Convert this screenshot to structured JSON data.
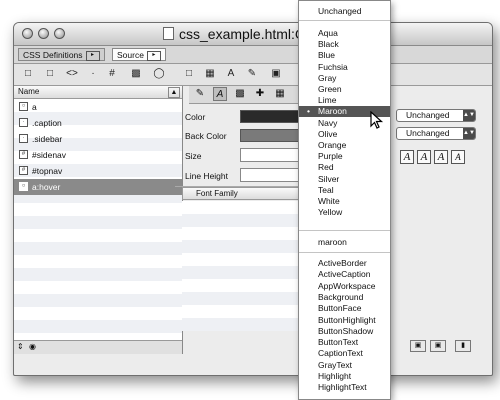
{
  "window": {
    "title": "css_example.html:CSS"
  },
  "tabs": [
    {
      "label": "CSS Definitions"
    },
    {
      "label": "Source"
    }
  ],
  "toolbar_icons": [
    "new-selector-icon",
    "new-class-icon",
    "code-icon",
    "dot-icon",
    "hash-icon",
    "folder-icon",
    "comment-icon",
    "page-icon",
    "grid-icon",
    "font-icon",
    "pen-icon",
    "image-icon"
  ],
  "left_panel": {
    "column_header": "Name",
    "items": [
      {
        "label": "a",
        "selected": false
      },
      {
        "label": ".caption",
        "selected": false
      },
      {
        "label": ".sidebar",
        "selected": false
      },
      {
        "label": "#sidenav",
        "selected": false
      },
      {
        "label": "#topnav",
        "selected": false
      },
      {
        "label": "a:hover",
        "selected": true
      }
    ]
  },
  "properties": {
    "color_label": "Color",
    "back_color_label": "Back Color",
    "size_label": "Size",
    "line_height_label": "Line Height",
    "font_family_header": "Font Family",
    "color_value": "#2a2a2a",
    "back_color_value": "#7a7a7a",
    "select_1": "Unchanged",
    "select_2": "Unchanged"
  },
  "color_menu": {
    "top": "Unchanged",
    "named": [
      "Aqua",
      "Black",
      "Blue",
      "Fuchsia",
      "Gray",
      "Green",
      "Lime",
      "Maroon",
      "Navy",
      "Olive",
      "Orange",
      "Purple",
      "Red",
      "Silver",
      "Teal",
      "White",
      "Yellow"
    ],
    "selected": "Maroon",
    "current": "maroon",
    "system": [
      "ActiveBorder",
      "ActiveCaption",
      "AppWorkspace",
      "Background",
      "ButtonFace",
      "ButtonHighlight",
      "ButtonShadow",
      "ButtonText",
      "CaptionText",
      "GrayText",
      "Highlight",
      "HighlightText"
    ]
  }
}
